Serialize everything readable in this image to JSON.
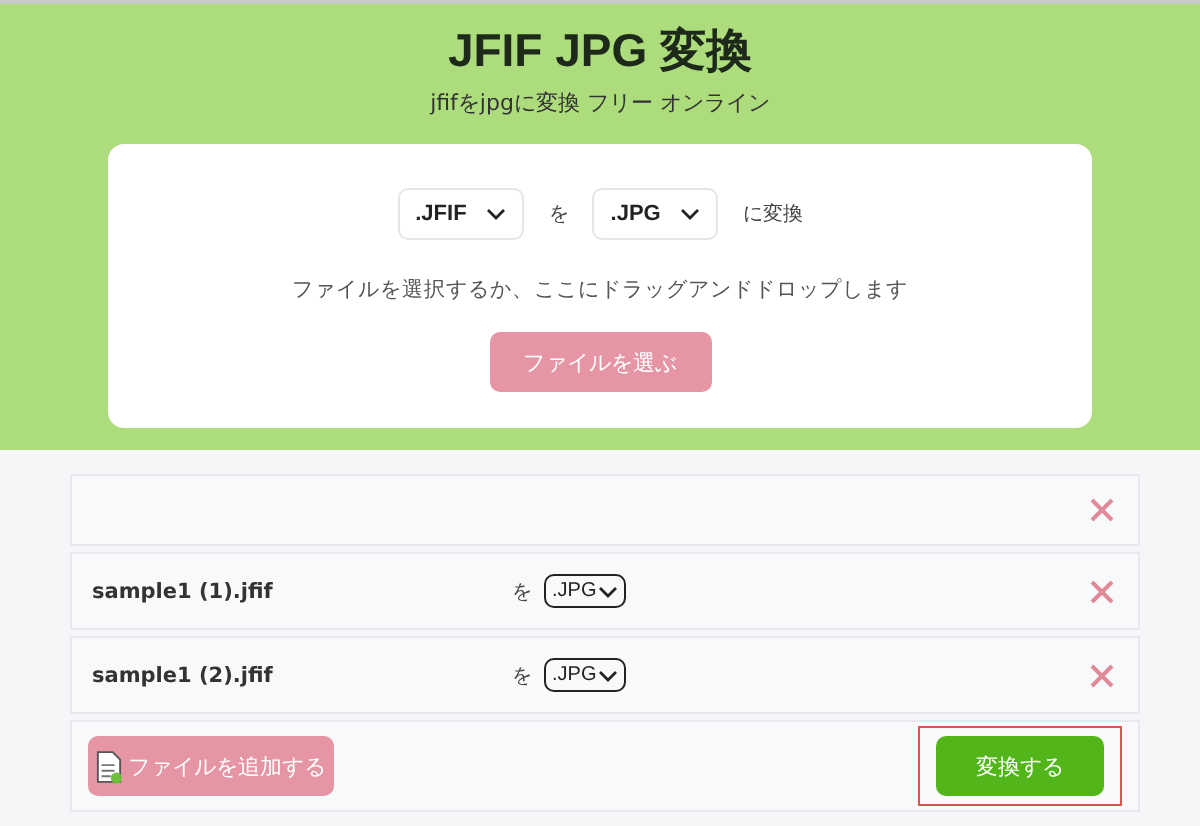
{
  "header": {
    "title": "JFIF JPG 変換",
    "subtitle": "jfifをjpgに変換 フリー オンライン"
  },
  "converter": {
    "from_format": ".JFIF",
    "joiner": "を",
    "to_format": ".JPG",
    "suffix": "に変換",
    "hint": "ファイルを選択するか、ここにドラッグアンドドロップします",
    "choose_button": "ファイルを選ぶ"
  },
  "files": [
    {
      "kind": "empty"
    },
    {
      "kind": "file",
      "name": "sample1 (1).jfif",
      "joiner": "を",
      "format": ".JPG"
    },
    {
      "kind": "file",
      "name": "sample1 (2).jfif",
      "joiner": "を",
      "format": ".JPG"
    }
  ],
  "actions": {
    "add_button": "ファイルを追加する",
    "convert_button": "変換する",
    "convert_highlighted": true
  }
}
